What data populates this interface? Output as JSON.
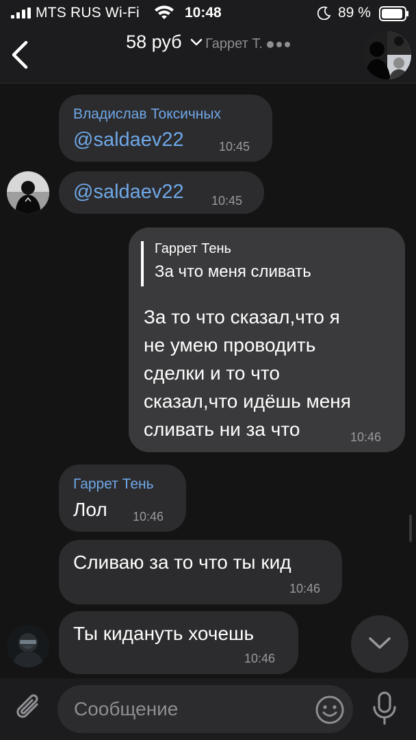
{
  "status_bar": {
    "carrier": "MTS RUS Wi-Fi",
    "time": "10:48",
    "battery": "89 %",
    "icons": [
      "signal-icon",
      "wifi-icon",
      "moon-icon",
      "battery-icon"
    ]
  },
  "header": {
    "title": "58 руб",
    "subtitle": "Гаррет Т.",
    "icons": [
      "back-chevron-icon",
      "chevron-down-icon",
      "typing-dots-icon",
      "chat-avatar"
    ]
  },
  "messages": [
    {
      "sender": "Владислав Токсичных",
      "text": "@saldaev22",
      "time": "10:45",
      "direction": "in"
    },
    {
      "text": "@saldaev22",
      "time": "10:45",
      "direction": "in"
    },
    {
      "direction": "out",
      "reply_to": {
        "name": "Гаррет Тень",
        "text": "За что меня сливать"
      },
      "lines": [
        "За то что сказал,что я",
        "не умею проводить",
        "сделки и то что",
        "сказал,что идёшь меня",
        "сливать ни за что"
      ],
      "time": "10:46"
    },
    {
      "sender": "Гаррет Тень",
      "text": "Лол",
      "time": "10:46",
      "direction": "in"
    },
    {
      "text": "Сливаю за то что ты кид",
      "time": "10:46",
      "direction": "in"
    },
    {
      "text": "Ты кидануть хочешь",
      "time": "10:46",
      "direction": "in"
    }
  ],
  "input": {
    "placeholder": "Сообщение",
    "icons": [
      "paperclip-icon",
      "emoji-icon",
      "microphone-icon"
    ]
  },
  "colors": {
    "background": "#141414",
    "bar": "#1c1c1e",
    "bubble_in": "#2c2c2e",
    "bubble_out": "#3a3a3c",
    "accent": "#6fa8e8",
    "secondary_text": "#8e8e93"
  }
}
